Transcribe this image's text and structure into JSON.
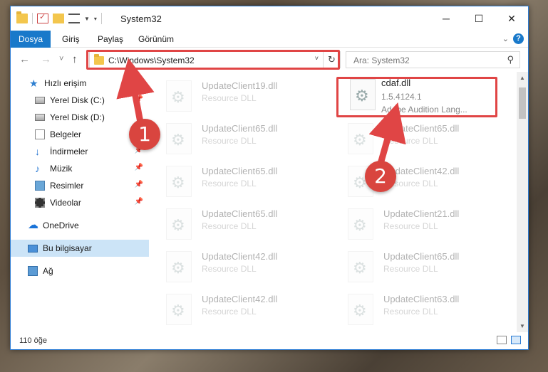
{
  "window": {
    "title": "System32",
    "controls": {
      "minimize": "─",
      "maximize": "☐",
      "close": "✕"
    }
  },
  "ribbon": {
    "tabs": [
      {
        "label": "Dosya"
      },
      {
        "label": "Giriş"
      },
      {
        "label": "Paylaş"
      },
      {
        "label": "Görünüm"
      }
    ],
    "help": "?"
  },
  "nav": {
    "back": "←",
    "forward": "→",
    "recent": "˅",
    "up": "↑",
    "address": "C:\\Windows\\System32",
    "search_placeholder": "Ara: System32"
  },
  "sidebar": {
    "items": [
      {
        "label": "Hızlı erişim",
        "icon": "star-icon"
      },
      {
        "label": "Yerel Disk (C:)",
        "icon": "drive-icon"
      },
      {
        "label": "Yerel Disk (D:)",
        "icon": "drive-icon"
      },
      {
        "label": "Belgeler",
        "icon": "documents-icon"
      },
      {
        "label": "İndirmeler",
        "icon": "downloads-icon"
      },
      {
        "label": "Müzik",
        "icon": "music-icon"
      },
      {
        "label": "Resimler",
        "icon": "pictures-icon"
      },
      {
        "label": "Videolar",
        "icon": "videos-icon"
      },
      {
        "label": "OneDrive",
        "icon": "cloud-icon"
      },
      {
        "label": "Bu bilgisayar",
        "icon": "computer-icon"
      },
      {
        "label": "Ağ",
        "icon": "network-icon"
      }
    ]
  },
  "files": {
    "selected": {
      "name": "cdaf.dll",
      "version": "1.5.4124.1",
      "description": "Adobe Audition Lang..."
    },
    "ghosts": [
      {
        "name": "UpdateClient19.dll",
        "type": "Resource DLL"
      },
      {
        "name": "UpdateClient65.dll",
        "type": "Resource DLL"
      },
      {
        "name": "UpdateClient65.dll",
        "type": "Resource DLL"
      },
      {
        "name": "UpdateClient65.dll",
        "type": "Resource DLL"
      },
      {
        "name": "UpdateClient42.dll",
        "type": "Resource DLL"
      },
      {
        "name": "UpdateClient42.dll",
        "type": "Resource DLL"
      },
      {
        "name": "UpdateClient65.dll",
        "type": "Resource DLL"
      },
      {
        "name": "UpdateClient42.dll",
        "type": "Resource DLL"
      },
      {
        "name": "UpdateClient21.dll",
        "type": "Resource DLL"
      },
      {
        "name": "UpdateClient65.dll",
        "type": "Resource DLL"
      },
      {
        "name": "UpdateClient63.dll",
        "type": "Resource DLL"
      }
    ]
  },
  "status": {
    "count": "110 öğe"
  },
  "annotations": {
    "step1": "1",
    "step2": "2"
  },
  "colors": {
    "accent": "#1979ca",
    "annotation": "#e04545"
  }
}
